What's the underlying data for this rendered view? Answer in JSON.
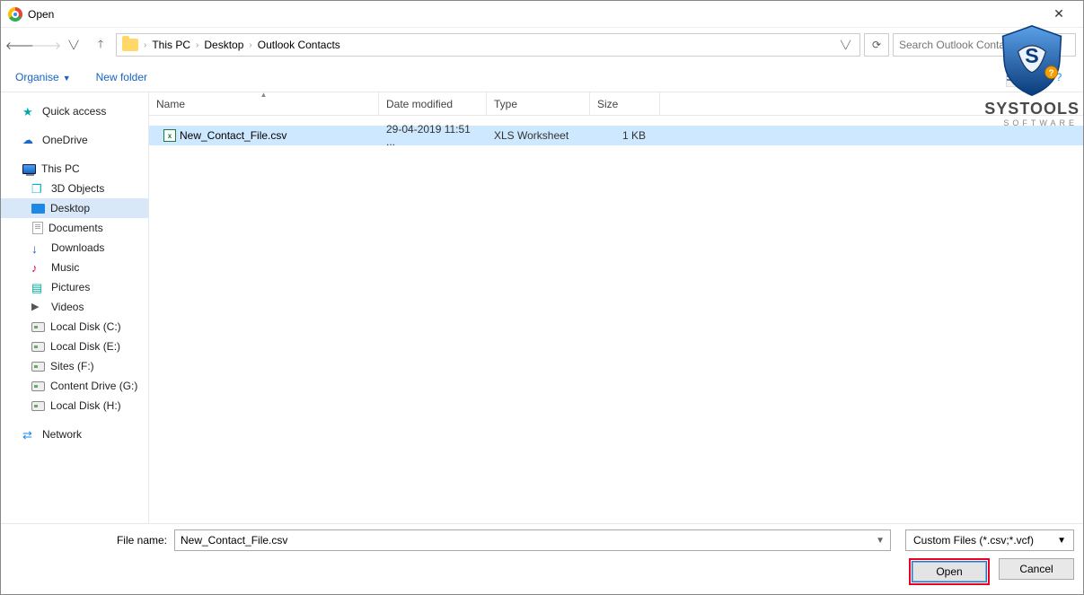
{
  "window": {
    "title": "Open"
  },
  "address": {
    "crumbs": [
      "This PC",
      "Desktop",
      "Outlook Contacts"
    ]
  },
  "search": {
    "placeholder": "Search Outlook Contacts"
  },
  "toolbar": {
    "organise": "Organise",
    "newfolder": "New folder"
  },
  "nav": {
    "quick": "Quick access",
    "onedrive": "OneDrive",
    "thispc": "This PC",
    "threed": "3D Objects",
    "desktop": "Desktop",
    "documents": "Documents",
    "downloads": "Downloads",
    "music": "Music",
    "pictures": "Pictures",
    "videos": "Videos",
    "diskc": "Local Disk (C:)",
    "diske": "Local Disk (E:)",
    "sitesf": "Sites (F:)",
    "contentg": "Content Drive (G:)",
    "diskh": "Local Disk (H:)",
    "network": "Network"
  },
  "columns": {
    "name": "Name",
    "date": "Date modified",
    "type": "Type",
    "size": "Size"
  },
  "files": [
    {
      "name": "New_Contact_File.csv",
      "date": "29-04-2019 11:51 ...",
      "type": "XLS Worksheet",
      "size": "1 KB"
    }
  ],
  "bottom": {
    "label": "File name:",
    "filename": "New_Contact_File.csv",
    "filter": "Custom Files (*.csv;*.vcf)",
    "open": "Open",
    "cancel": "Cancel"
  },
  "watermark": {
    "t1": "SYSTOOLS",
    "t2": "SOFTWARE"
  }
}
